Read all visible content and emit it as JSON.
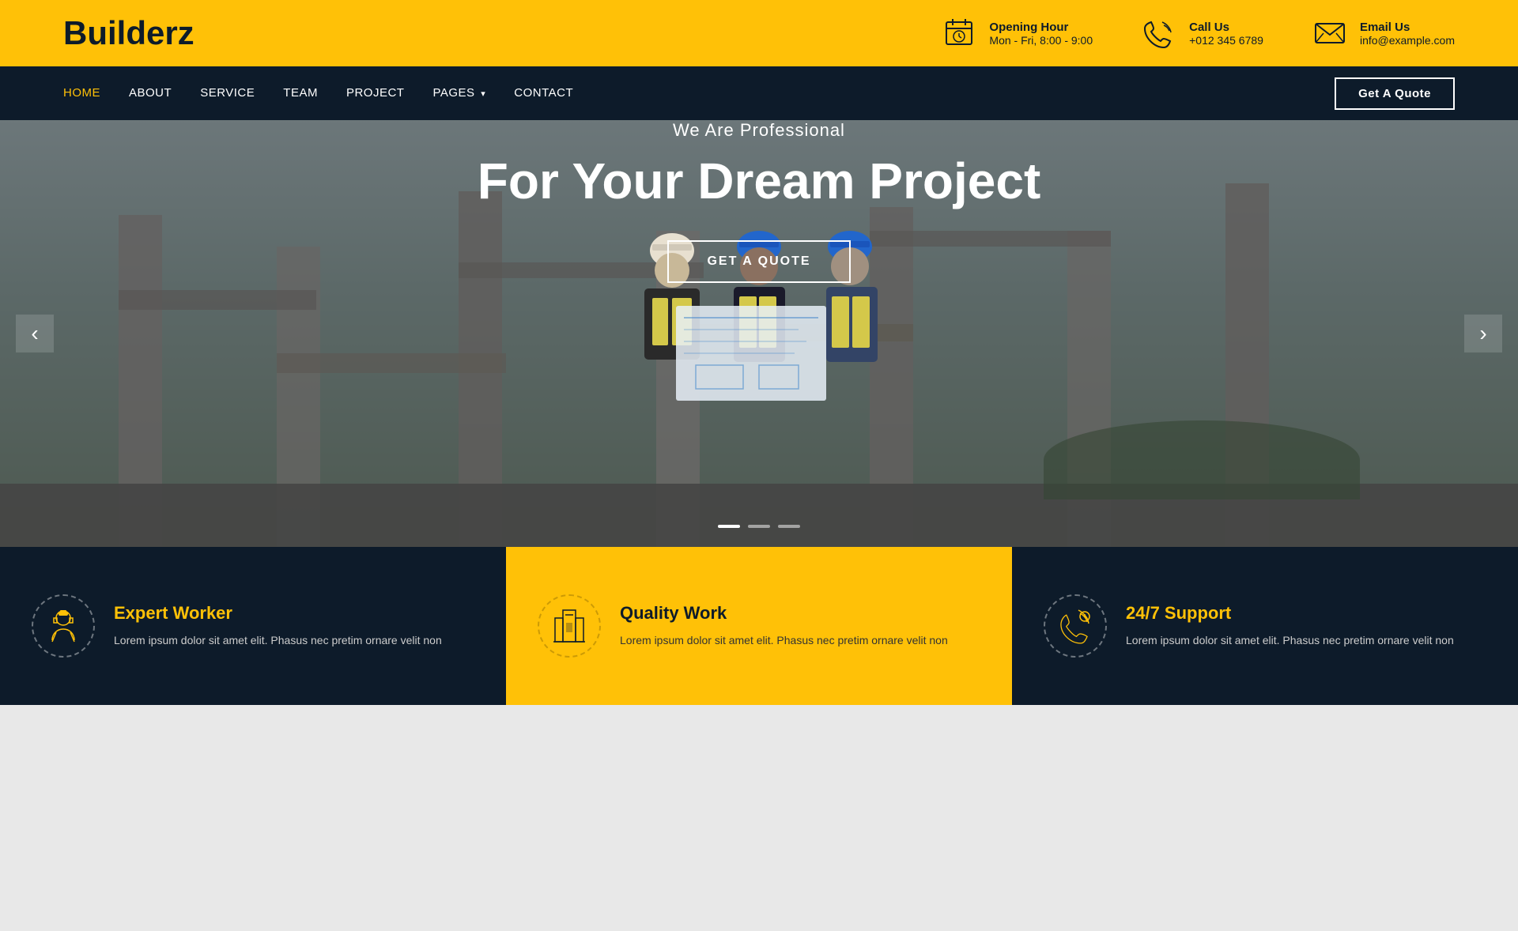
{
  "brand": {
    "name": "Builderz"
  },
  "topbar": {
    "opening_hour_label": "Opening Hour",
    "opening_hour_value": "Mon - Fri, 8:00 - 9:00",
    "call_us_label": "Call Us",
    "call_us_value": "+012 345 6789",
    "email_us_label": "Email Us",
    "email_us_value": "info@example.com"
  },
  "nav": {
    "items": [
      {
        "label": "HOME",
        "active": true
      },
      {
        "label": "ABOUT",
        "active": false
      },
      {
        "label": "SERVICE",
        "active": false
      },
      {
        "label": "TEAM",
        "active": false
      },
      {
        "label": "PROJECT",
        "active": false
      },
      {
        "label": "PAGES",
        "active": false,
        "dropdown": true
      },
      {
        "label": "CONTACT",
        "active": false
      }
    ],
    "cta_label": "Get A Quote"
  },
  "hero": {
    "subtitle": "We Are Professional",
    "title": "For Your Dream Project",
    "cta_label": "GET A QUOTE",
    "dots": [
      {
        "active": true
      },
      {
        "active": false
      },
      {
        "active": false
      }
    ]
  },
  "cards": [
    {
      "title": "Expert Worker",
      "description": "Lorem ipsum dolor sit amet elit. Phasus nec pretim ornare velit non",
      "icon": "👷"
    },
    {
      "title": "Quality Work",
      "description": "Lorem ipsum dolor sit amet elit. Phasus nec pretim ornare velit non",
      "icon": "🏗️"
    },
    {
      "title": "24/7 Support",
      "description": "Lorem ipsum dolor sit amet elit. Phasus nec pretim ornare velit non",
      "icon": "📞"
    }
  ],
  "colors": {
    "primary": "#FFC107",
    "dark": "#0d1b2a",
    "white": "#ffffff"
  }
}
